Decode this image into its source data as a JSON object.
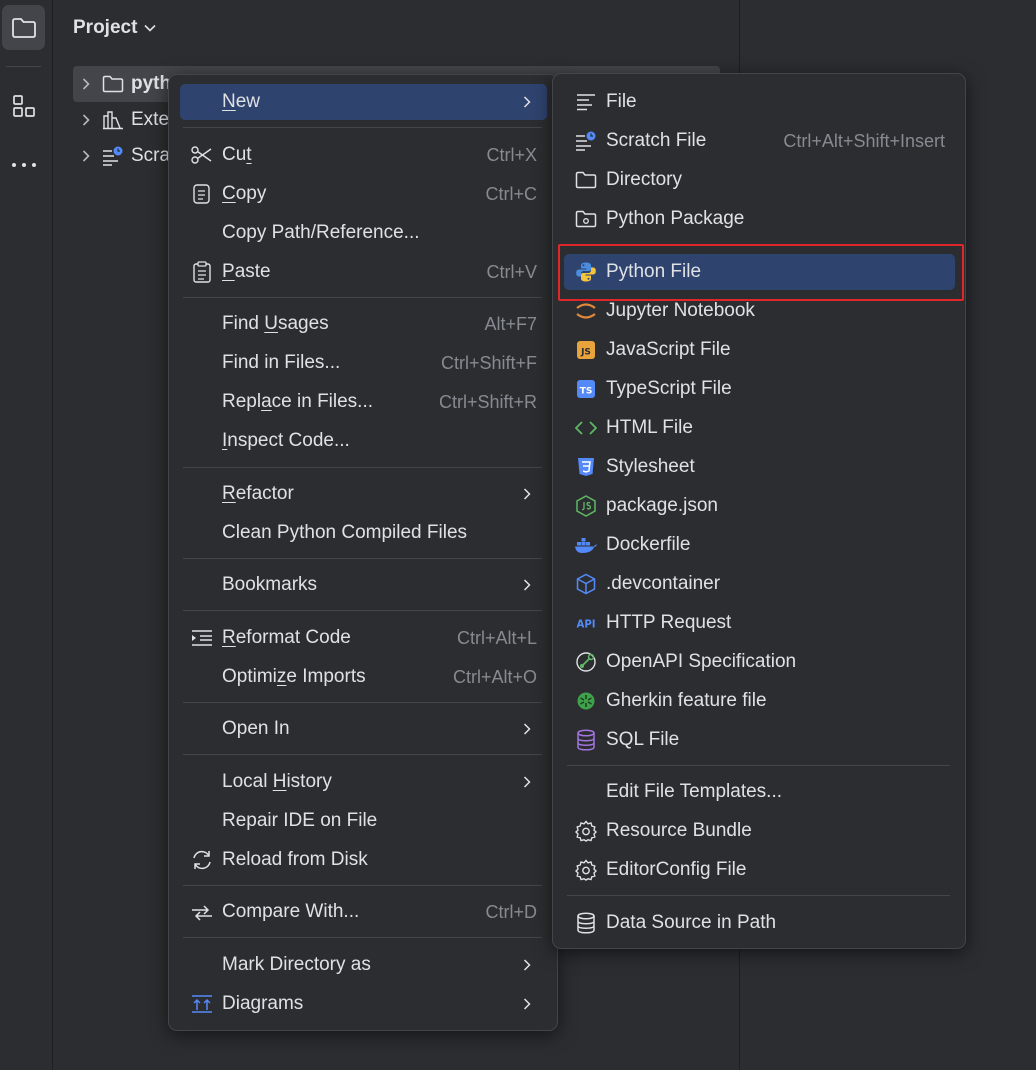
{
  "project_panel": {
    "title": "Project",
    "tree": [
      {
        "label": "pyth",
        "selected": true,
        "icon": "folder-icon"
      },
      {
        "label": "Exte",
        "icon": "external-libraries-icon"
      },
      {
        "label": "Scra",
        "icon": "scratches-icon"
      }
    ]
  },
  "toolstrip": {
    "items": [
      "project-folder-icon",
      "structure-icon",
      "more-icon"
    ]
  },
  "context_menu": {
    "new": {
      "pre": "",
      "u": "N",
      "post": "ew"
    },
    "cut": {
      "pre": "Cu",
      "u": "t",
      "post": "",
      "shortcut": "Ctrl+X"
    },
    "copy": {
      "pre": "",
      "u": "C",
      "post": "opy",
      "shortcut": "Ctrl+C"
    },
    "copy_path": {
      "label": "Copy Path/Reference..."
    },
    "paste": {
      "pre": "",
      "u": "P",
      "post": "aste",
      "shortcut": "Ctrl+V"
    },
    "find_usages": {
      "pre": "Find ",
      "u": "U",
      "post": "sages",
      "shortcut": "Alt+F7"
    },
    "find_in_files": {
      "label": "Find in Files...",
      "shortcut": "Ctrl+Shift+F"
    },
    "replace_in_files": {
      "pre": "Repl",
      "u": "a",
      "post": "ce in Files...",
      "shortcut": "Ctrl+Shift+R"
    },
    "inspect_code": {
      "pre": "",
      "u": "I",
      "post": "nspect Code..."
    },
    "refactor": {
      "pre": "",
      "u": "R",
      "post": "efactor"
    },
    "clean_python": {
      "label": "Clean Python Compiled Files"
    },
    "bookmarks": {
      "label": "Bookmarks"
    },
    "reformat_code": {
      "pre": "",
      "u": "R",
      "post": "eformat Code",
      "shortcut": "Ctrl+Alt+L"
    },
    "optimize_imports": {
      "pre": "Optimi",
      "u": "z",
      "post": "e Imports",
      "shortcut": "Ctrl+Alt+O"
    },
    "open_in": {
      "label": "Open In"
    },
    "local_history": {
      "pre": "Local ",
      "u": "H",
      "post": "istory"
    },
    "repair_ide": {
      "label": "Repair IDE on File"
    },
    "reload_from_disk": {
      "label": "Reload from Disk"
    },
    "compare_with": {
      "label": "Compare With...",
      "shortcut": "Ctrl+D"
    },
    "mark_directory": {
      "label": "Mark Directory as"
    },
    "diagrams": {
      "label": "Diagrams"
    }
  },
  "new_submenu": {
    "file": "File",
    "scratch_file": {
      "label": "Scratch File",
      "shortcut": "Ctrl+Alt+Shift+Insert"
    },
    "directory": "Directory",
    "python_package": "Python Package",
    "python_file": "Python File",
    "jupyter": "Jupyter Notebook",
    "javascript": "JavaScript File",
    "typescript": "TypeScript File",
    "html": "HTML File",
    "stylesheet": "Stylesheet",
    "package_json": "package.json",
    "dockerfile": "Dockerfile",
    "devcontainer": ".devcontainer",
    "http_request": "HTTP Request",
    "openapi": "OpenAPI Specification",
    "gherkin": "Gherkin feature file",
    "sql": "SQL File",
    "edit_templates": "Edit File Templates...",
    "resource_bundle": "Resource Bundle",
    "editorconfig": "EditorConfig File",
    "data_source": "Data Source in Path",
    "badges": {
      "js": "JS",
      "ts": "TS",
      "api": "API"
    }
  },
  "colors": {
    "background": "#2b2d30",
    "highlight": "#2e436e",
    "separator": "#43454a",
    "shortcut_text": "#868a91",
    "annotation_box": "#e0262b"
  }
}
